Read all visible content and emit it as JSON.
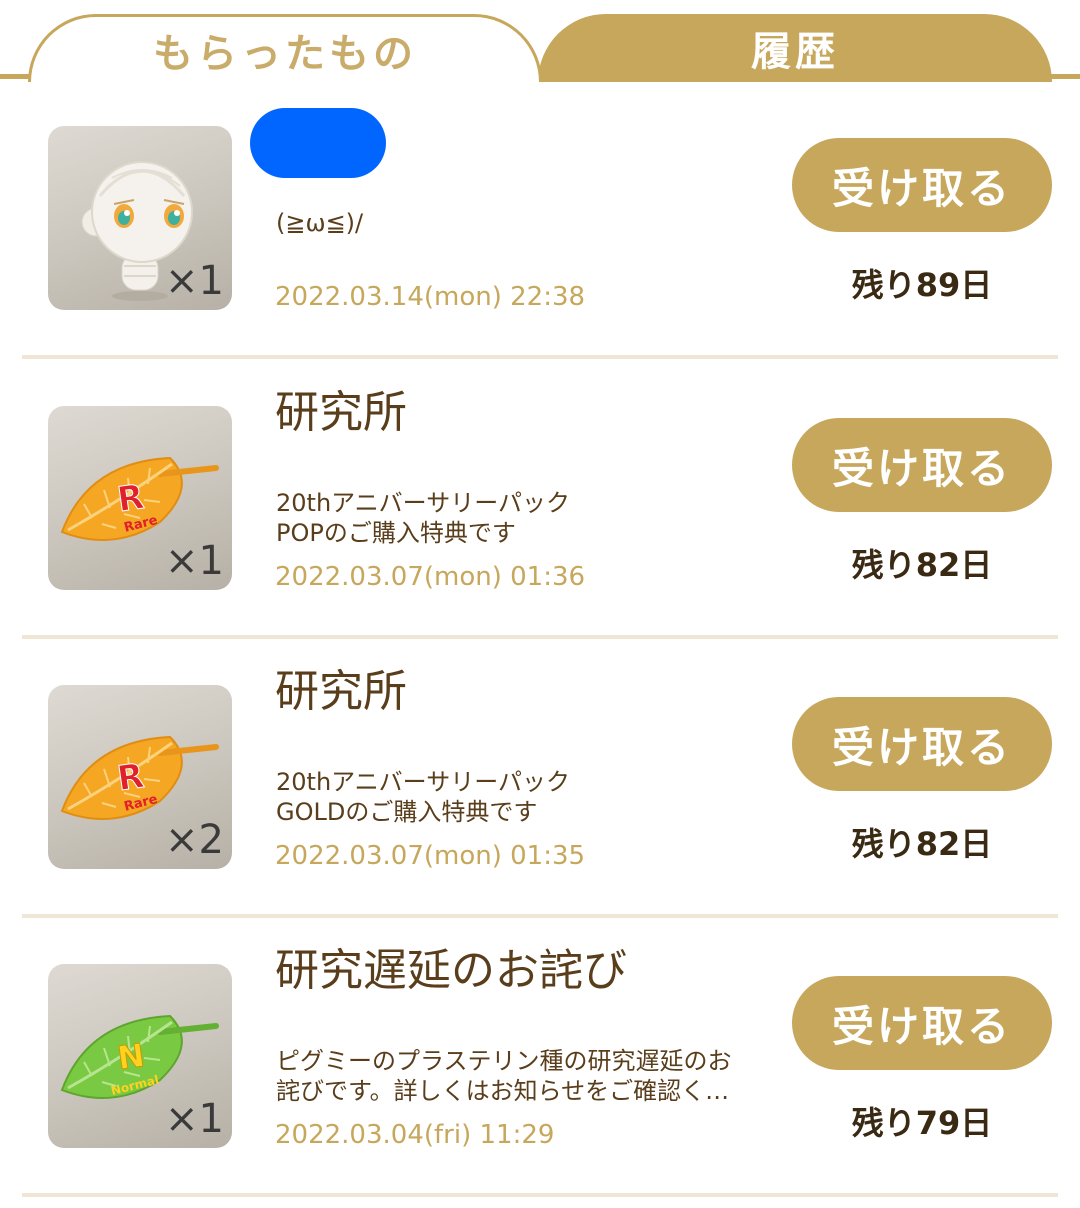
{
  "tabs": {
    "received_label": "もらったもの",
    "history_label": "履歴",
    "active": "received"
  },
  "gifts": [
    {
      "title": "",
      "title_redacted": true,
      "description": "(≧ω≦)/",
      "date": "2022.03.14(mon) 22:38",
      "quantity": "×1",
      "item_icon": "doll-head-icon",
      "button_label": "受け取る",
      "remaining": "残り89日"
    },
    {
      "title": "研究所",
      "description": "20thアニバーサリーパック\nPOPのご購入特典です",
      "date": "2022.03.07(mon) 01:36",
      "quantity": "×1",
      "item_icon": "rare-leaf-icon",
      "item_badge_letter": "R",
      "item_badge_word": "Rare",
      "button_label": "受け取る",
      "remaining": "残り82日"
    },
    {
      "title": "研究所",
      "description": "20thアニバーサリーパック\nGOLDのご購入特典です",
      "date": "2022.03.07(mon) 01:35",
      "quantity": "×2",
      "item_icon": "rare-leaf-icon",
      "item_badge_letter": "R",
      "item_badge_word": "Rare",
      "button_label": "受け取る",
      "remaining": "残り82日"
    },
    {
      "title": "研究遅延のお詫び",
      "description": "ピグミーのプラステリン種の研究遅延のお\n詫びです。詳しくはお知らせをご確認く…",
      "date": "2022.03.04(fri) 11:29",
      "quantity": "×1",
      "item_icon": "normal-leaf-icon",
      "item_badge_letter": "N",
      "item_badge_word": "Normal",
      "button_label": "受け取る",
      "remaining": "残り79日"
    }
  ],
  "colors": {
    "accent_gold": "#c6a75b",
    "title_brown": "#5a3e1b",
    "divider": "#f0e6d6",
    "rare_leaf": "#f5a623",
    "normal_leaf": "#7ac943",
    "redaction": "#0066ff"
  }
}
